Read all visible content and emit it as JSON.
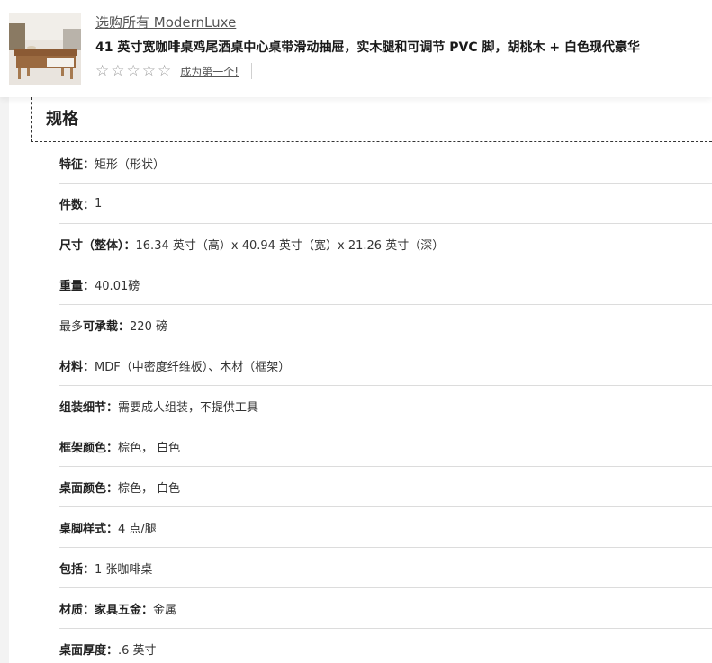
{
  "header": {
    "brand_link": "选购所有 ModernLuxe",
    "product_title": "41 英寸宽咖啡桌鸡尾酒桌中心桌带滑动抽屉，实木腿和可调节 PVC 脚，胡桃木 + 白色现代豪华",
    "rating": {
      "stars": [
        "☆",
        "☆",
        "☆",
        "☆",
        "☆"
      ],
      "filled_count": 0,
      "review_link": "成为第一个!"
    }
  },
  "specs": {
    "heading": "规格",
    "rows": [
      {
        "pre": "",
        "label": "特征：",
        "value": "矩形（形状）"
      },
      {
        "pre": "",
        "label": "件数：",
        "value": "1"
      },
      {
        "pre": "",
        "label": "尺寸（整体）：",
        "value": "16.34 英寸（高）x 40.94 英寸（宽）x 21.26 英寸（深）"
      },
      {
        "pre": "",
        "label": "重量：",
        "value": "40.01磅"
      },
      {
        "pre": "最多",
        "label": "可承载：",
        "value": "220 磅"
      },
      {
        "pre": "",
        "label": "材料：",
        "value": "MDF（中密度纤维板）、木材（框架）"
      },
      {
        "pre": "",
        "label": "组装细节：",
        "value": "需要成人组装，不提供工具"
      },
      {
        "pre": "",
        "label": "框架颜色：",
        "value": "棕色， 白色"
      },
      {
        "pre": "",
        "label": "桌面颜色：",
        "value": "棕色， 白色"
      },
      {
        "pre": "",
        "label": "桌脚样式：",
        "value": "4 点/腿"
      },
      {
        "pre": "",
        "label": "包括：",
        "value": "1 张咖啡桌"
      },
      {
        "pre": "",
        "label": "材质：家具五金：",
        "value": "金属"
      },
      {
        "pre": "",
        "label": "桌面厚度：",
        "value": ".6 英寸"
      }
    ]
  },
  "colors": {
    "page_bg": "#f3f3f3",
    "star_empty": "#9a9a9a",
    "divider": "#dcdcdc"
  }
}
